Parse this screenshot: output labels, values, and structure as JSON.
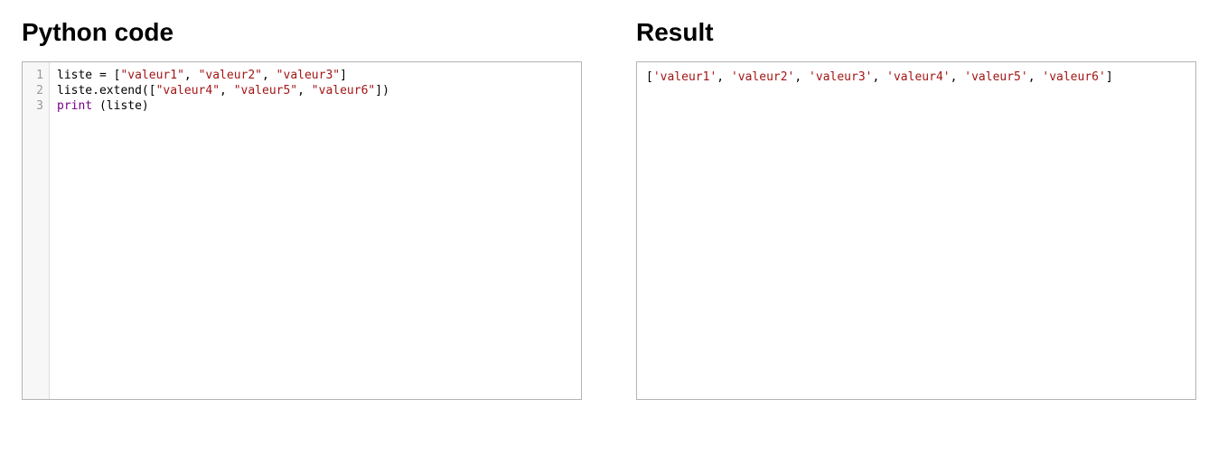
{
  "left": {
    "title": "Python code",
    "lines": [
      {
        "num": "1",
        "tokens": [
          {
            "t": "liste = ["
          },
          {
            "t": "\"valeur1\"",
            "c": "tok-str"
          },
          {
            "t": ", "
          },
          {
            "t": "\"valeur2\"",
            "c": "tok-str"
          },
          {
            "t": ", "
          },
          {
            "t": "\"valeur3\"",
            "c": "tok-str"
          },
          {
            "t": "]"
          }
        ]
      },
      {
        "num": "2",
        "tokens": [
          {
            "t": "liste.extend(["
          },
          {
            "t": "\"valeur4\"",
            "c": "tok-str"
          },
          {
            "t": ", "
          },
          {
            "t": "\"valeur5\"",
            "c": "tok-str"
          },
          {
            "t": ", "
          },
          {
            "t": "\"valeur6\"",
            "c": "tok-str"
          },
          {
            "t": "])"
          }
        ]
      },
      {
        "num": "3",
        "tokens": [
          {
            "t": "print",
            "c": "tok-kw"
          },
          {
            "t": " (liste)"
          }
        ]
      }
    ]
  },
  "right": {
    "title": "Result",
    "output_tokens": [
      {
        "t": "["
      },
      {
        "t": "'valeur1'",
        "c": "out-str"
      },
      {
        "t": ", "
      },
      {
        "t": "'valeur2'",
        "c": "out-str"
      },
      {
        "t": ", "
      },
      {
        "t": "'valeur3'",
        "c": "out-str"
      },
      {
        "t": ", "
      },
      {
        "t": "'valeur4'",
        "c": "out-str"
      },
      {
        "t": ", "
      },
      {
        "t": "'valeur5'",
        "c": "out-str"
      },
      {
        "t": ", "
      },
      {
        "t": "'valeur6'",
        "c": "out-str"
      },
      {
        "t": "]"
      }
    ]
  }
}
